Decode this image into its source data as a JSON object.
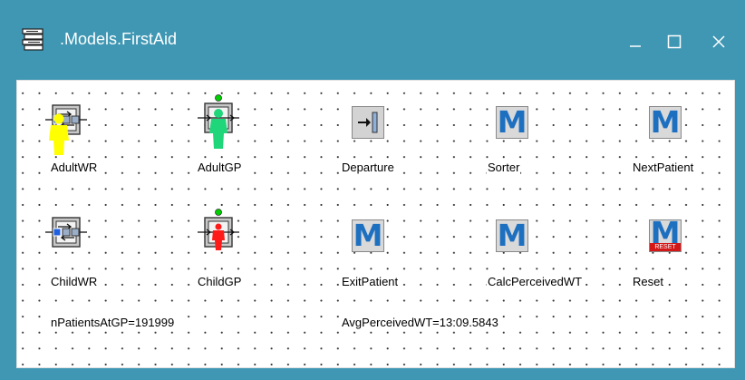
{
  "window": {
    "title": ".Models.FirstAid",
    "accent": "#3f97b3",
    "icon": "model-stack-icon",
    "controls": [
      "minimize-icon",
      "maximize-icon",
      "close-icon"
    ]
  },
  "blocks": [
    {
      "label": "AdultWR",
      "icon": "wait-queue-icon"
    },
    {
      "label": "AdultGP",
      "icon": "server-person-icon"
    },
    {
      "label": "Departure",
      "icon": "departure-icon"
    },
    {
      "label": "Sorter",
      "icon": "method-m-icon"
    },
    {
      "label": "NextPatient",
      "icon": "method-m-icon"
    },
    {
      "label": "ChildWR",
      "icon": "wait-queue-icon"
    },
    {
      "label": "ChildGP",
      "icon": "server-person-icon"
    },
    {
      "label": "ExitPatient",
      "icon": "method-m-icon"
    },
    {
      "label": "CalcPerceivedWT",
      "icon": "method-m-icon"
    },
    {
      "label": "Reset",
      "icon": "reset-method-icon"
    }
  ],
  "m_letter": "M",
  "reset_badge": "RESET",
  "variables": {
    "n_patients": "nPatientsAtGP=191999",
    "avg_wt": "AvgPerceivedWT=13:09.5843"
  },
  "colors": {
    "person_yellow": "#ffff00",
    "person_green": "#1fd67a",
    "person_red": "#ff1a1a",
    "status_led": "#00d000",
    "m_blue": "#1d6fc0",
    "reset_red": "#d41818"
  }
}
